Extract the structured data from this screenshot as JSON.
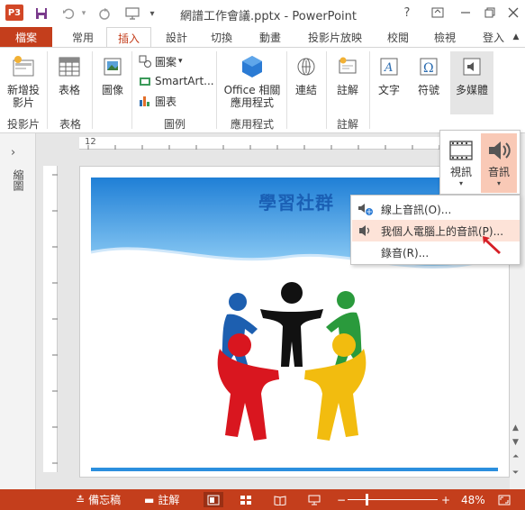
{
  "window": {
    "title": "網譜工作會議.pptx - PowerPoint",
    "help": "?",
    "app_icon_text": "P3"
  },
  "tabs": [
    "檔案",
    "常用",
    "插入",
    "設計",
    "切換",
    "動畫",
    "投影片放映",
    "校閱",
    "檢視",
    "登入"
  ],
  "ribbon": {
    "new_slide": "新增投\n影片",
    "table": "表格",
    "image": "圖像",
    "shapes": "圖案",
    "smartart": "SmartArt...",
    "chart": "圖表",
    "office_apps": "Office 相關\n應用程式",
    "links": "連結",
    "comment": "註解",
    "text": "文字",
    "symbols": "符號",
    "media": "多媒體",
    "groups": {
      "slides": "投影片",
      "tables": "表格",
      "illustrations": "圖例",
      "apps": "應用程式",
      "comments": "註解"
    }
  },
  "media_panel": {
    "video": "視訊",
    "audio": "音訊"
  },
  "audio_menu": {
    "items": [
      "線上音訊(O)...",
      "我個人電腦上的音訊(P)...",
      "錄音(R)..."
    ]
  },
  "left_pane": {
    "label": "縮圖"
  },
  "slide": {
    "title": "學習社群"
  },
  "rulers": {
    "h_left_label": "12"
  },
  "status": {
    "notes": "備忘稿",
    "comments": "註解",
    "zoom": "48%"
  },
  "colors": {
    "accent": "#c43e1c",
    "highlight": "#fde3d8",
    "slide_blue": "#2b8fde"
  }
}
